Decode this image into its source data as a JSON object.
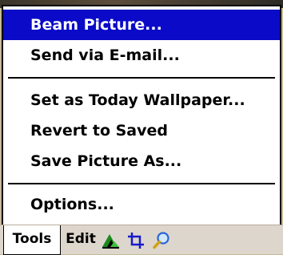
{
  "menu": {
    "items": [
      {
        "label": "Beam Picture...",
        "selected": true
      },
      {
        "label": "Send via E-mail..."
      },
      {
        "label": "Set as Today Wallpaper..."
      },
      {
        "label": "Revert to Saved"
      },
      {
        "label": "Save Picture As..."
      },
      {
        "label": "Options..."
      }
    ]
  },
  "toolbar": {
    "tabs": [
      {
        "label": "Tools",
        "active": true
      },
      {
        "label": "Edit"
      }
    ],
    "icons": [
      "image-adjust-icon",
      "crop-icon",
      "zoom-icon"
    ]
  },
  "colors": {
    "selection": "#0a0ac8",
    "toolbar_bg": "#ddd6cc",
    "backdrop": "#c8b99a"
  }
}
